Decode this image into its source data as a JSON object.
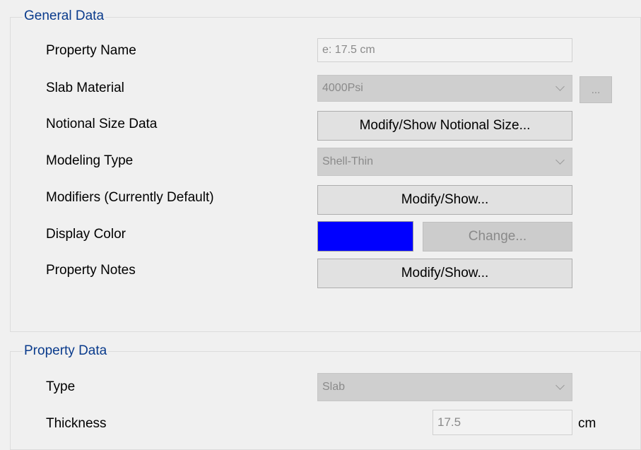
{
  "general": {
    "title": "General Data",
    "property_name_label": "Property Name",
    "property_name_value": "e: 17.5 cm",
    "slab_material_label": "Slab Material",
    "slab_material_value": "4000Psi",
    "slab_material_browse": "...",
    "notional_label": "Notional Size Data",
    "notional_button": "Modify/Show Notional Size...",
    "modeling_label": "Modeling Type",
    "modeling_value": "Shell-Thin",
    "modifiers_label": "Modifiers (Currently Default)",
    "modifiers_button": "Modify/Show...",
    "color_label": "Display Color",
    "display_color": "#0000ff",
    "change_button": "Change...",
    "notes_label": "Property Notes",
    "notes_button": "Modify/Show..."
  },
  "property": {
    "title": "Property Data",
    "type_label": "Type",
    "type_value": "Slab",
    "thickness_label": "Thickness",
    "thickness_value": "17.5",
    "thickness_unit": "cm"
  },
  "icons": {
    "dropdown": "chevron-down-icon"
  }
}
